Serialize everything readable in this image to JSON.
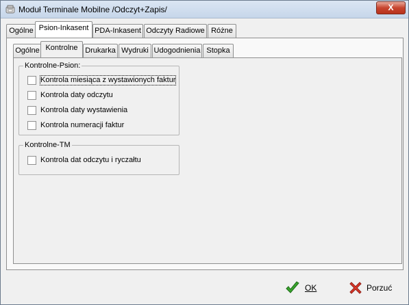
{
  "window": {
    "title": "Moduł Terminale Mobilne /Odczyt+Zapis/",
    "close_label": "X"
  },
  "tabs_top": [
    {
      "label": "Ogólne"
    },
    {
      "label": "Psion-Inkasent"
    },
    {
      "label": "PDA-Inkasent"
    },
    {
      "label": "Odczyty Radiowe"
    },
    {
      "label": "Różne"
    }
  ],
  "tabs_inner": [
    {
      "label": "Ogólne"
    },
    {
      "label": "Kontrolne"
    },
    {
      "label": "Drukarka"
    },
    {
      "label": "Wydruki"
    },
    {
      "label": "Udogodnienia"
    },
    {
      "label": "Stopka"
    }
  ],
  "groups": {
    "psion": {
      "legend": "Kontrolne-Psion:",
      "items": [
        {
          "label": "Kontrola miesiąca z wystawionych faktur",
          "checked": false
        },
        {
          "label": "Kontrola daty odczytu",
          "checked": false
        },
        {
          "label": "Kontrola daty wystawienia",
          "checked": false
        },
        {
          "label": "Kontrola numeracji faktur",
          "checked": false
        }
      ]
    },
    "tm": {
      "legend": "Kontrolne-TM",
      "items": [
        {
          "label": "Kontrola dat odczytu i ryczałtu",
          "checked": false
        }
      ]
    }
  },
  "buttons": {
    "ok": "OK",
    "cancel": "Porzuć"
  }
}
